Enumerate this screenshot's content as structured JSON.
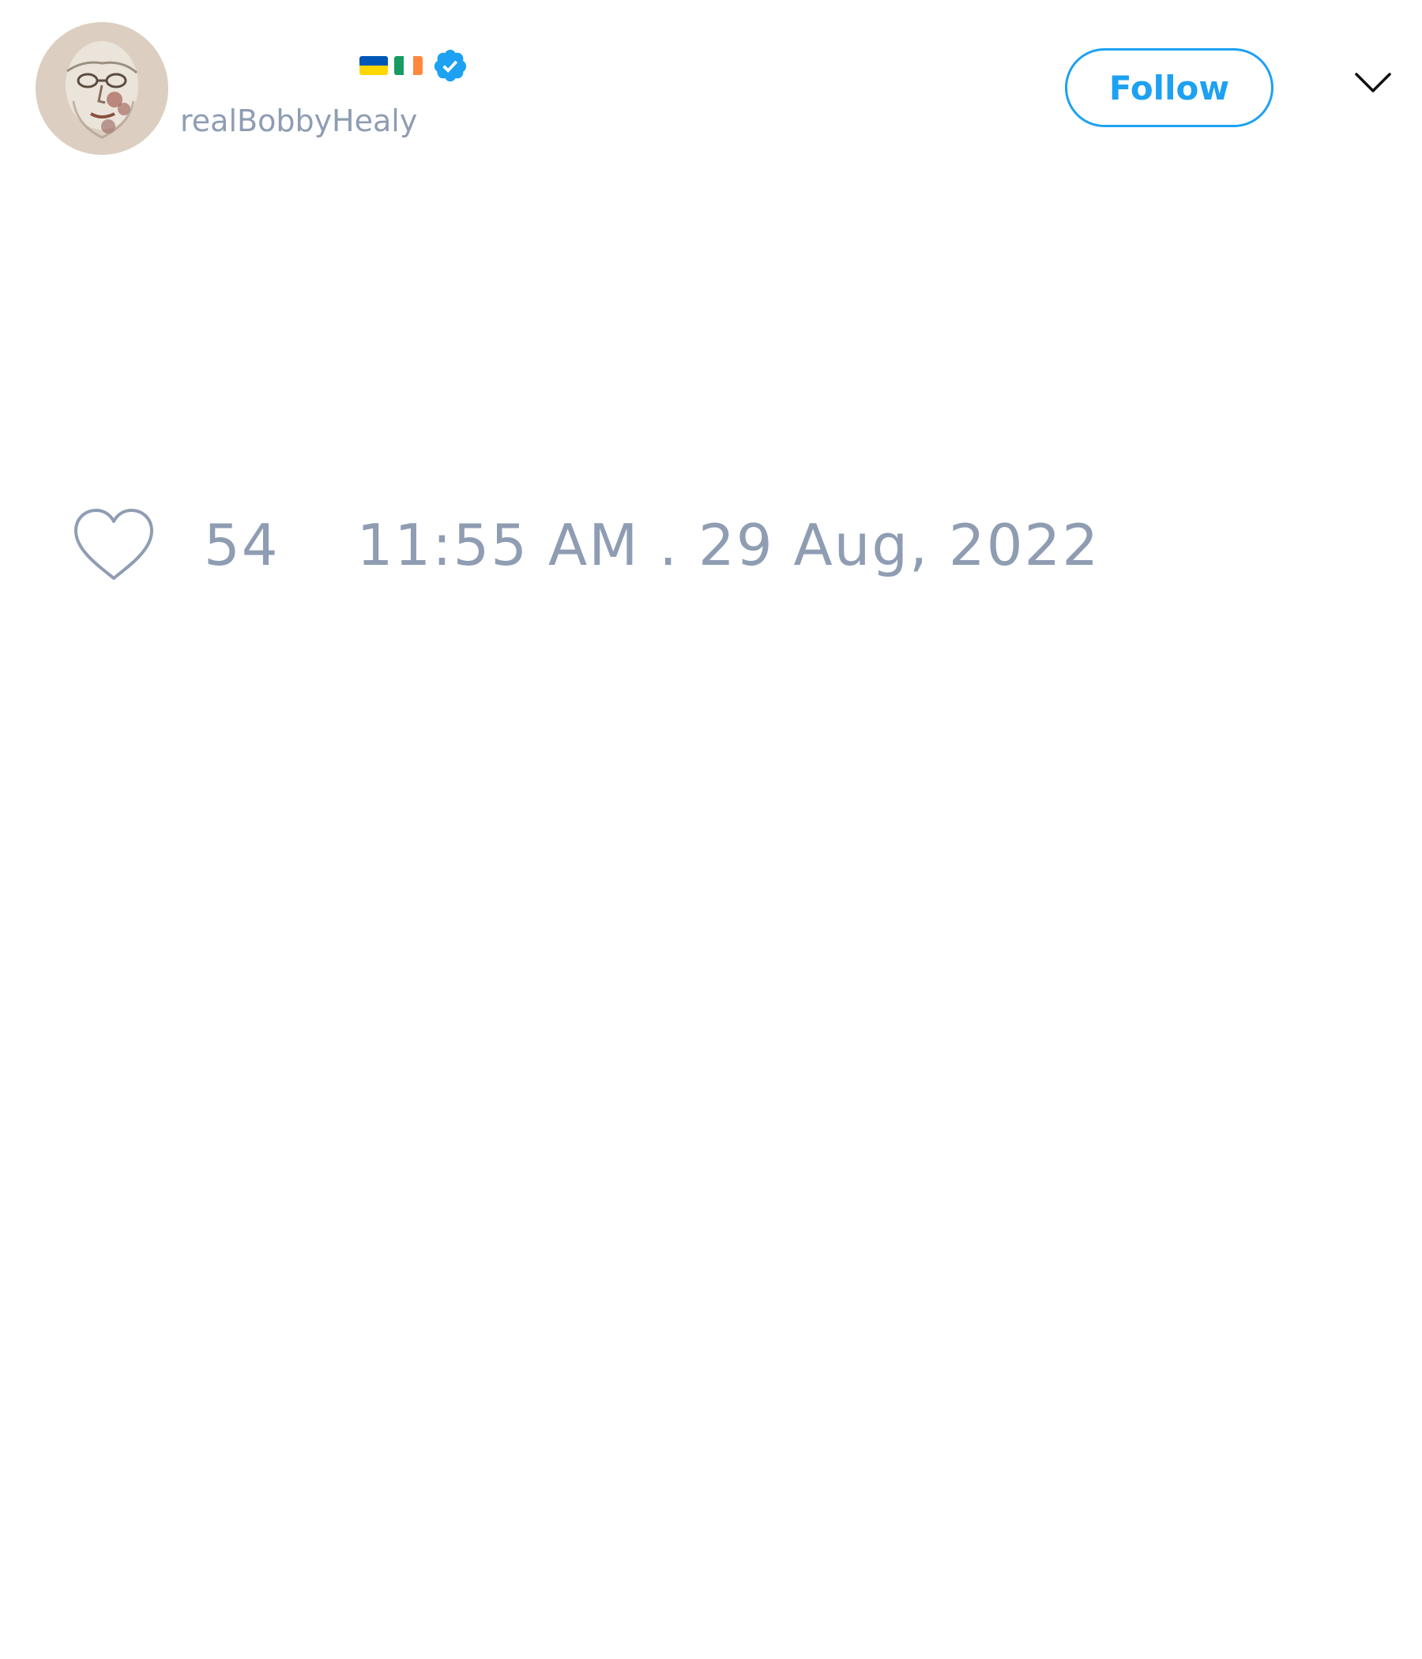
{
  "tweet": {
    "author": {
      "flags": [
        "ukraine-flag",
        "ireland-flag"
      ],
      "verified_icon": "verified-badge-icon",
      "handle": "realBobbyHealy"
    },
    "follow_button_label": "Follow",
    "menu_icon": "chevron-down-icon",
    "like_icon": "heart-icon",
    "like_count": "54",
    "timestamp": "11:55 AM . 29 Aug, 2022"
  },
  "colors": {
    "accent": "#1da1f2",
    "muted_text": "#8f9db3",
    "background": "#ffffff"
  }
}
